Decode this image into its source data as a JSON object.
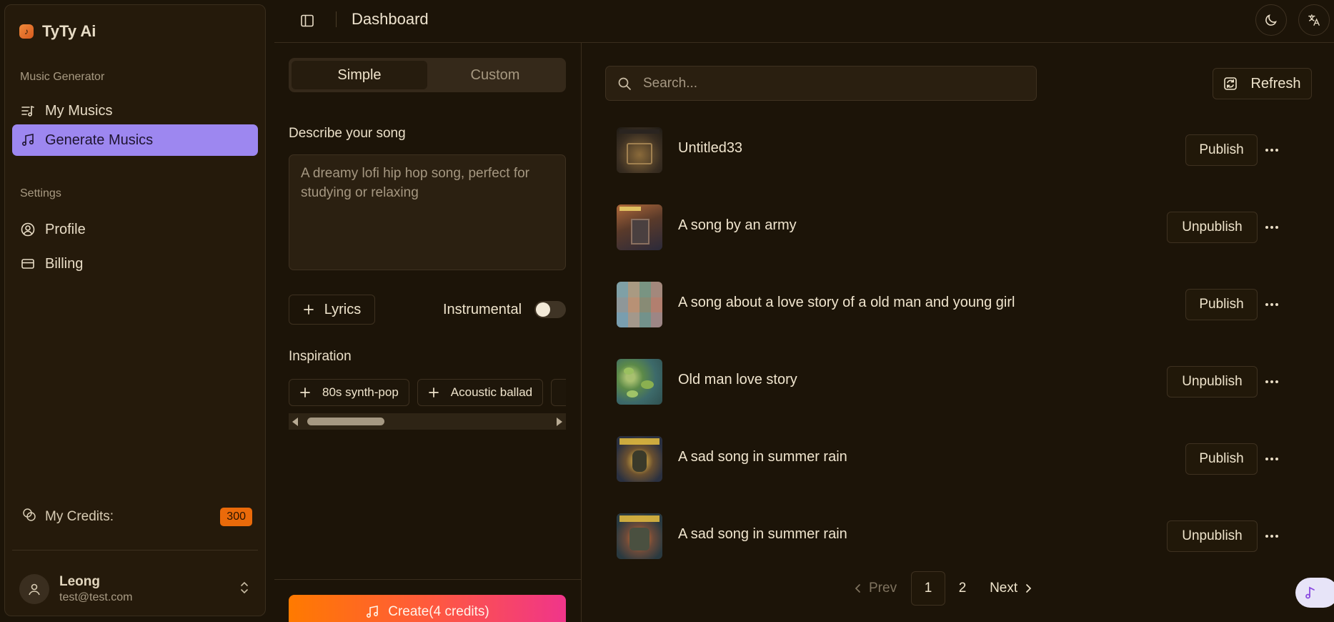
{
  "sidebar": {
    "brand": "TyTy Ai",
    "music_group": "Music Generator",
    "my_musics": "My Musics",
    "generate_musics": "Generate Musics",
    "settings_group": "Settings",
    "profile": "Profile",
    "billing": "Billing",
    "credits_label": "My Credits:",
    "credits_value": "300",
    "user_name": "Leong",
    "user_email": "test@test.com"
  },
  "header": {
    "title": "Dashboard"
  },
  "create_panel": {
    "tabs": [
      "Simple",
      "Custom"
    ],
    "describe_label": "Describe your song",
    "describe_placeholder": "A dreamy lofi hip hop song, perfect for studying or relaxing",
    "lyrics_button": "Lyrics",
    "instrumental_label": "Instrumental",
    "instrumental_on": false,
    "inspiration_label": "Inspiration",
    "chips": [
      "80s synth-pop",
      "Acoustic ballad",
      ""
    ],
    "create_button": "Create(4 credits)"
  },
  "list_panel": {
    "search_placeholder": "Search...",
    "refresh_button": "Refresh",
    "songs": [
      {
        "title": "Untitled33",
        "action": "Publish"
      },
      {
        "title": "A song by an army",
        "action": "Unpublish"
      },
      {
        "title": "A song about a love story of a old man and young girl",
        "action": "Publish"
      },
      {
        "title": "Old man love story",
        "action": "Unpublish"
      },
      {
        "title": "A sad song in summer rain",
        "action": "Publish"
      },
      {
        "title": "A sad song in summer rain",
        "action": "Unpublish"
      }
    ],
    "pagination": {
      "prev": "Prev",
      "pages": [
        "1",
        "2"
      ],
      "current": "1",
      "next": "Next"
    }
  },
  "colors": {
    "background": "#1c1408",
    "accent_purple": "#9d87f0",
    "credits_orange": "#ea6a0a",
    "create_gradient_start": "#ff7a00",
    "create_gradient_end": "#f0358a"
  }
}
